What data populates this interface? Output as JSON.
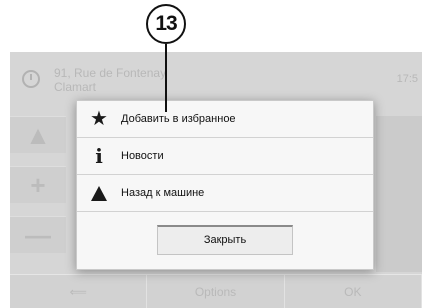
{
  "callout": {
    "number": "13"
  },
  "background": {
    "address_line1": "91, Rue de Fontenay",
    "address_line2": "Clamart",
    "time": "17:5",
    "zoom_in_symbol": "+",
    "zoom_out_symbol": "—",
    "bottom_bar": [
      "⟸",
      "Options",
      "OK"
    ]
  },
  "popup": {
    "items": [
      {
        "label": "Добавить в избранное",
        "icon": "star-icon"
      },
      {
        "label": "Новости",
        "icon": "info-icon"
      },
      {
        "label": "Назад к машине",
        "icon": "vehicle-arrow-icon"
      }
    ],
    "close_label": "Закрыть"
  }
}
